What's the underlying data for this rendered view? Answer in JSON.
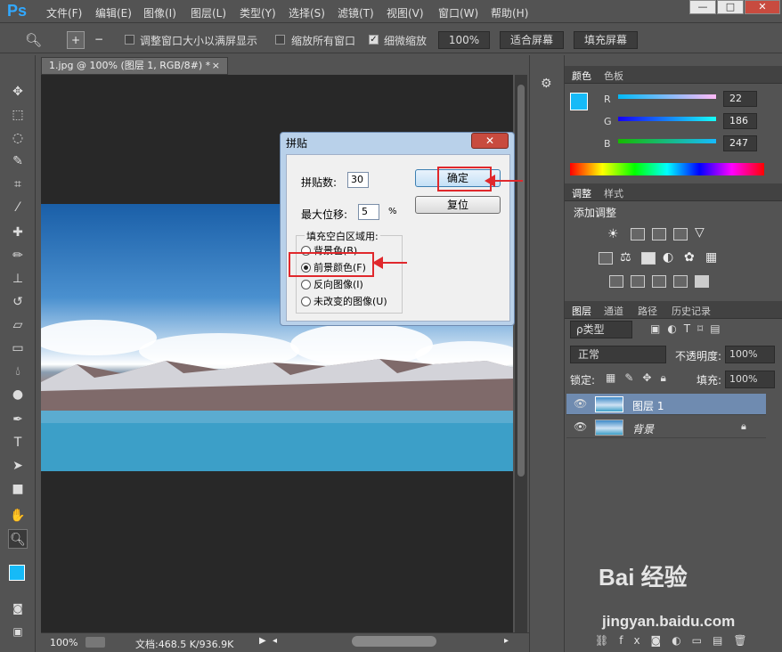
{
  "app": {
    "logo": "Ps"
  },
  "menu": [
    "文件(F)",
    "编辑(E)",
    "图像(I)",
    "图层(L)",
    "类型(Y)",
    "选择(S)",
    "滤镜(T)",
    "视图(V)",
    "窗口(W)",
    "帮助(H)"
  ],
  "window_buttons": [
    "—",
    "□",
    "✕"
  ],
  "options": {
    "check1": "调整窗口大小以满屏显示",
    "check2": "缩放所有窗口",
    "check3": "细微缩放",
    "zoom_value": "100%",
    "fit_screen": "适合屏幕",
    "fill_screen": "填充屏幕"
  },
  "document": {
    "tab_title": "1.jpg @ 100% (图层 1, RGB/8#) *",
    "close": "×",
    "zoom": "100%",
    "doc_size": "文档:468.5 K/936.9K"
  },
  "color_panel": {
    "tabs": [
      "颜色",
      "色板"
    ],
    "r_label": "R",
    "g_label": "G",
    "b_label": "B",
    "r": "22",
    "g": "186",
    "b": "247",
    "foreground": "#16baf7"
  },
  "adjust_panel": {
    "tabs": [
      "调整",
      "样式"
    ],
    "add_label": "添加调整"
  },
  "layers_panel": {
    "tabs": [
      "图层",
      "通道",
      "路径",
      "历史记录"
    ],
    "filter": "ρ类型",
    "blend_mode": "正常",
    "opacity_label": "不透明度:",
    "opacity": "100%",
    "lock_label": "锁定:",
    "fill_label": "填充:",
    "fill": "100%",
    "layers": [
      {
        "name": "图层 1",
        "selected": true
      },
      {
        "name": "背景",
        "selected": false
      }
    ]
  },
  "dialog": {
    "title": "拼贴",
    "close": "✕",
    "tiles_label": "拼贴数:",
    "tiles_value": "30",
    "offset_label": "最大位移:",
    "offset_value": "5",
    "offset_unit": "%",
    "group_label": "填充空白区域用:",
    "options": [
      "背景色(B)",
      "前景颜色(F)",
      "反向图像(I)",
      "未改变的图像(U)"
    ],
    "selected_option": 1,
    "ok_label": "确定",
    "reset_label": "复位"
  },
  "watermark": {
    "line1": "Bai 经验",
    "line2": "jingyan.baidu.com"
  }
}
